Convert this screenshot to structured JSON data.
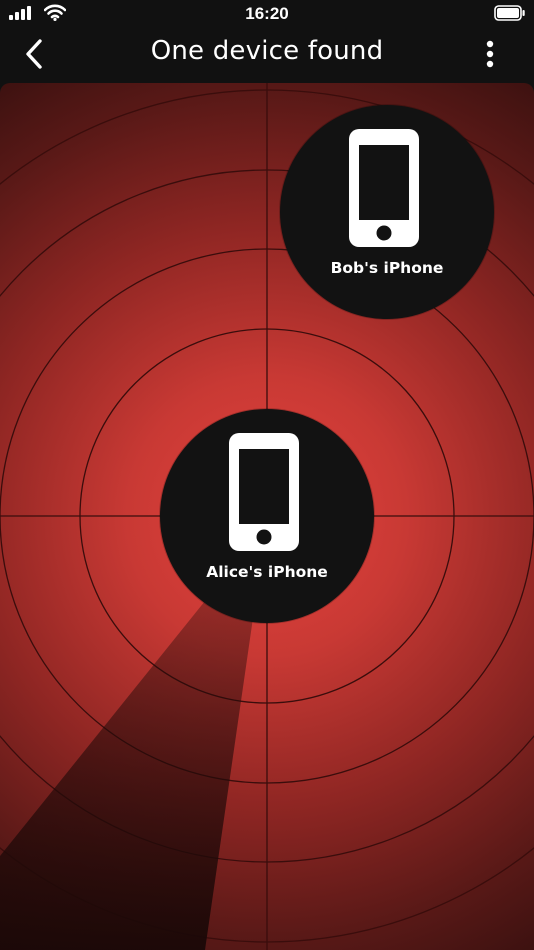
{
  "status_bar": {
    "time": "16:20",
    "icons": [
      "signal-icon",
      "wifi-icon",
      "battery-icon"
    ]
  },
  "nav": {
    "title": "One device found",
    "back_icon": "chevron-left-icon",
    "more_icon": "more-vertical-icon"
  },
  "radar": {
    "colors": {
      "center": "#e6433d",
      "edge": "#2c0d0c",
      "rings": "#3a0d0c",
      "device_bg": "#121212"
    }
  },
  "devices": [
    {
      "label": "Bob's iPhone",
      "icon": "smartphone-icon"
    },
    {
      "label": "Alice's iPhone",
      "icon": "smartphone-icon"
    }
  ]
}
